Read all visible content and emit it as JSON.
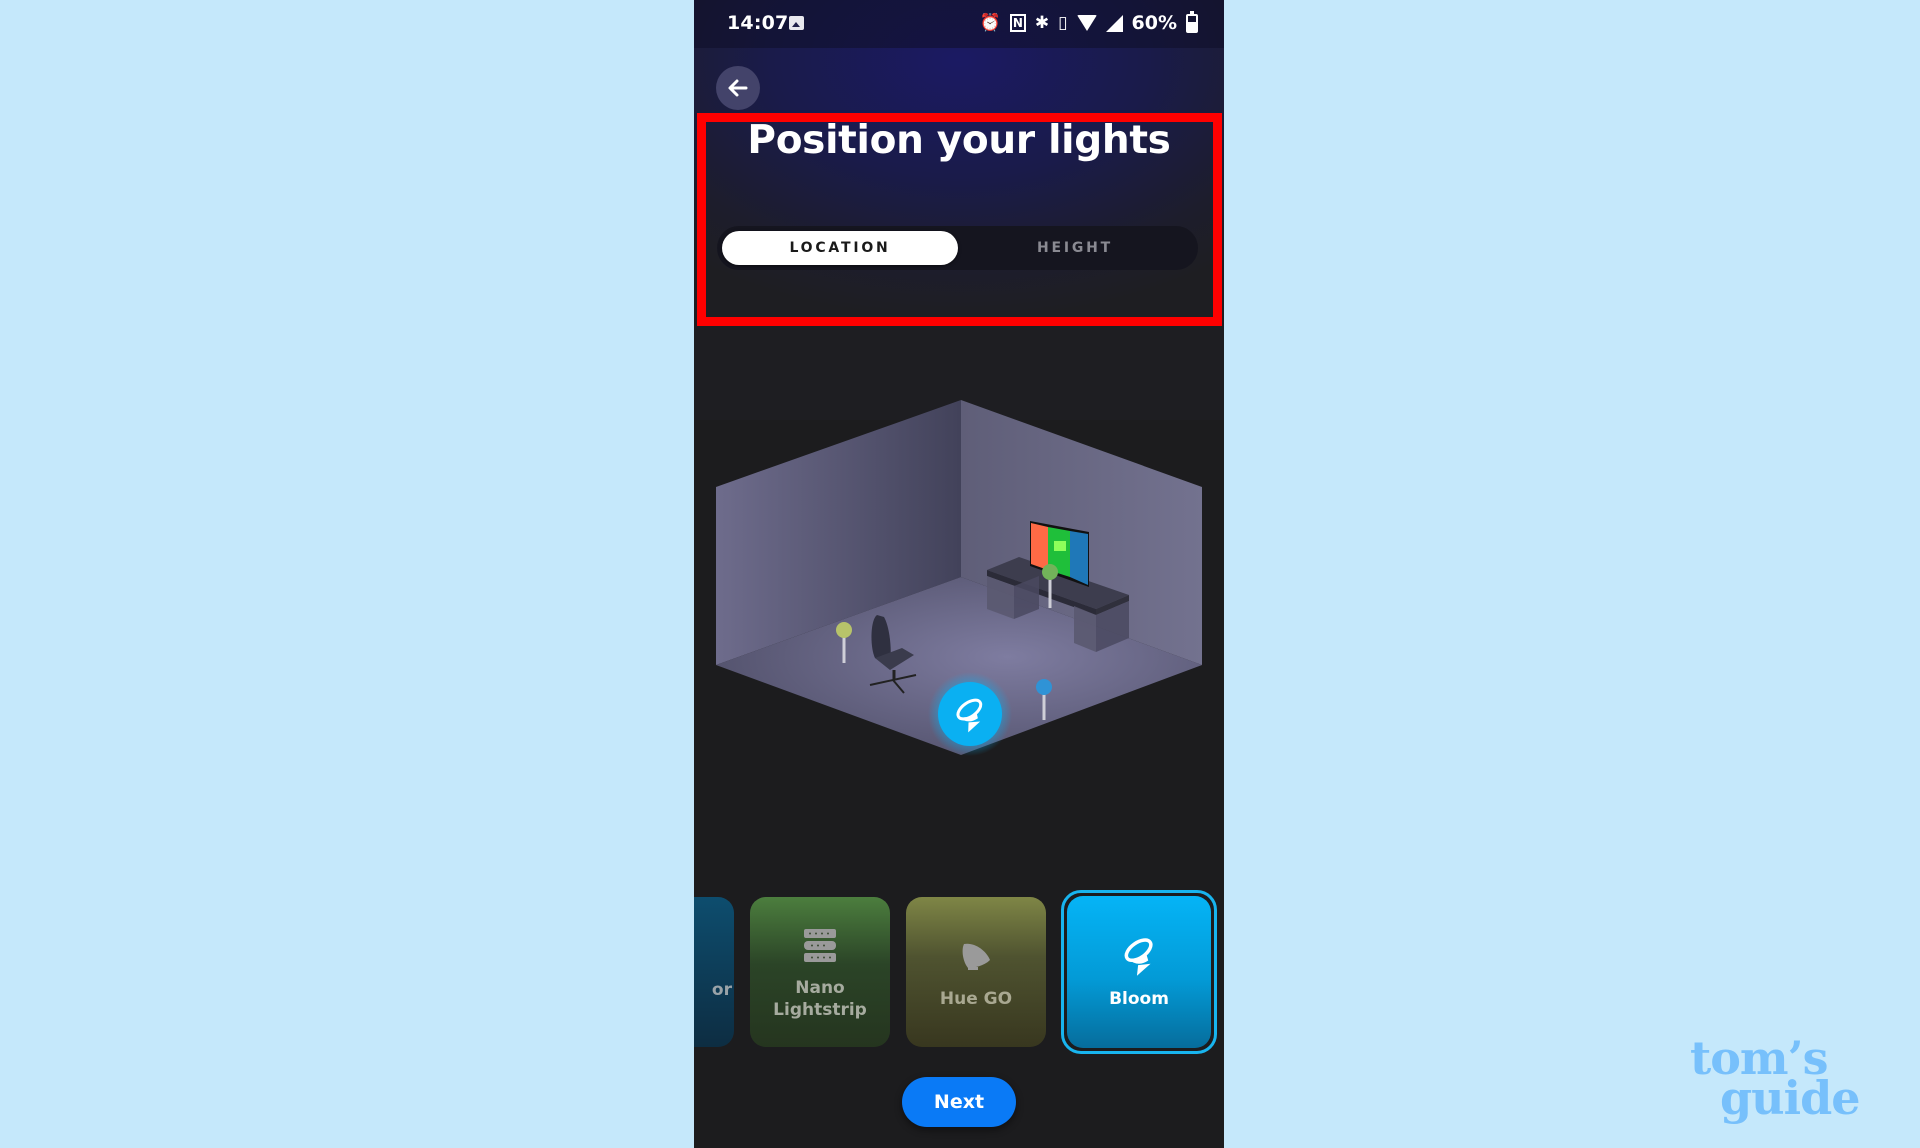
{
  "status_bar": {
    "time": "14:07",
    "battery": "60%",
    "icons": [
      "gallery-icon",
      "alarm-icon",
      "nfc-icon",
      "bluetooth-icon",
      "vibrate-icon",
      "wifi-icon",
      "signal-icon",
      "battery-icon"
    ]
  },
  "header": {
    "back_icon": "arrow-left-icon",
    "title": "Position your lights"
  },
  "segmented_control": {
    "options": [
      {
        "label": "LOCATION",
        "selected": true
      },
      {
        "label": "HEIGHT",
        "selected": false
      }
    ]
  },
  "room": {
    "lights": [
      {
        "name": "Bloom",
        "color": "#0ab0f2",
        "selected": true
      },
      {
        "name": "yellow-light",
        "color": "#b7c36a"
      },
      {
        "name": "green-light",
        "color": "#72b35a"
      },
      {
        "name": "blue-light",
        "color": "#2f93d6"
      }
    ]
  },
  "carousel": {
    "items": [
      {
        "label": "or",
        "partial": true,
        "color": "#0d4d6e"
      },
      {
        "label_line1": "Nano",
        "label_line2": "Lightstrip",
        "icon": "lightstrip-icon",
        "color": "#3d6a33"
      },
      {
        "label": "Hue GO",
        "icon": "hue-go-icon",
        "color": "#5c6036"
      },
      {
        "label": "Bloom",
        "icon": "bloom-icon",
        "selected": true,
        "color": "#05b4f6"
      }
    ]
  },
  "footer": {
    "next_label": "Next",
    "accent": "#0a7af6"
  },
  "watermark": {
    "line1": "tom’s",
    "line2": "guide"
  },
  "annotation": {
    "highlight_color": "#ff0000"
  }
}
